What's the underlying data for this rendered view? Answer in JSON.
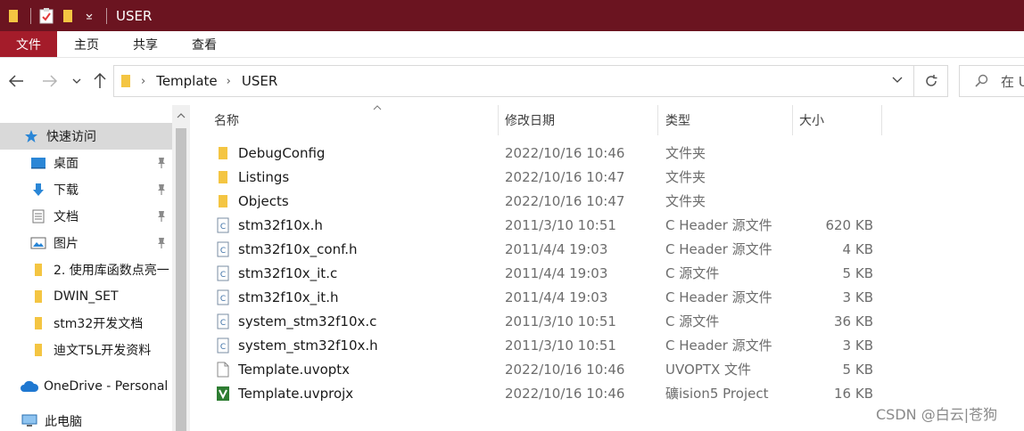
{
  "window": {
    "title": "USER"
  },
  "ribbon": {
    "tabs": [
      {
        "label": "文件"
      },
      {
        "label": "主页"
      },
      {
        "label": "共享"
      },
      {
        "label": "查看"
      }
    ]
  },
  "address": {
    "crumbs": [
      "Template",
      "USER"
    ]
  },
  "search": {
    "placeholder": "在 U"
  },
  "nav": {
    "items": [
      {
        "label": "快速访问",
        "icon": "star-icon",
        "pinned": false
      },
      {
        "label": "桌面",
        "icon": "desktop-icon",
        "pinned": true
      },
      {
        "label": "下载",
        "icon": "download-icon",
        "pinned": true
      },
      {
        "label": "文档",
        "icon": "document-icon",
        "pinned": true
      },
      {
        "label": "图片",
        "icon": "pictures-icon",
        "pinned": true
      },
      {
        "label": "2. 使用库函数点亮一",
        "icon": "folder-icon",
        "pinned": false
      },
      {
        "label": "DWIN_SET",
        "icon": "folder-icon",
        "pinned": false
      },
      {
        "label": "stm32开发文档",
        "icon": "folder-icon",
        "pinned": false
      },
      {
        "label": "迪文T5L开发资料",
        "icon": "folder-icon",
        "pinned": false
      },
      {
        "label": "OneDrive - Personal",
        "icon": "cloud-icon",
        "pinned": false
      },
      {
        "label": "此电脑",
        "icon": "computer-icon",
        "pinned": false
      }
    ]
  },
  "list": {
    "columns": {
      "name": "名称",
      "date": "修改日期",
      "type": "类型",
      "size": "大小"
    },
    "rows": [
      {
        "name": "DebugConfig",
        "date": "2022/10/16 10:46",
        "type": "文件夹",
        "size": "",
        "icon": "folder-icon"
      },
      {
        "name": "Listings",
        "date": "2022/10/16 10:47",
        "type": "文件夹",
        "size": "",
        "icon": "folder-icon"
      },
      {
        "name": "Objects",
        "date": "2022/10/16 10:47",
        "type": "文件夹",
        "size": "",
        "icon": "folder-icon"
      },
      {
        "name": "stm32f10x.h",
        "date": "2011/3/10 10:51",
        "type": "C Header 源文件",
        "size": "620 KB",
        "icon": "c-file-icon"
      },
      {
        "name": "stm32f10x_conf.h",
        "date": "2011/4/4 19:03",
        "type": "C Header 源文件",
        "size": "4 KB",
        "icon": "c-file-icon"
      },
      {
        "name": "stm32f10x_it.c",
        "date": "2011/4/4 19:03",
        "type": "C 源文件",
        "size": "5 KB",
        "icon": "c-file-icon"
      },
      {
        "name": "stm32f10x_it.h",
        "date": "2011/4/4 19:03",
        "type": "C Header 源文件",
        "size": "3 KB",
        "icon": "c-file-icon"
      },
      {
        "name": "system_stm32f10x.c",
        "date": "2011/3/10 10:51",
        "type": "C 源文件",
        "size": "36 KB",
        "icon": "c-file-icon"
      },
      {
        "name": "system_stm32f10x.h",
        "date": "2011/3/10 10:51",
        "type": "C Header 源文件",
        "size": "3 KB",
        "icon": "c-file-icon"
      },
      {
        "name": "Template.uvoptx",
        "date": "2022/10/16 10:46",
        "type": "UVOPTX 文件",
        "size": "5 KB",
        "icon": "blank-file-icon"
      },
      {
        "name": "Template.uvprojx",
        "date": "2022/10/16 10:46",
        "type": "礦ision5 Project",
        "size": "16 KB",
        "icon": "keil-project-icon"
      }
    ]
  },
  "watermark": "CSDN @白云|苍狗",
  "colors": {
    "titlebar": "#6b1420",
    "file_tab": "#a41c2a",
    "nav_selected": "#d9d9d9",
    "folder": "#f4c542"
  }
}
